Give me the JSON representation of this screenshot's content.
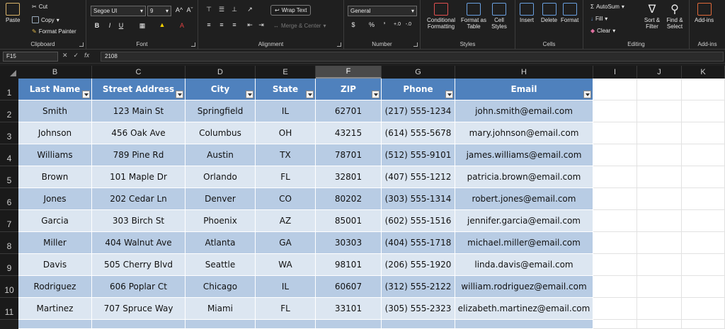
{
  "ribbon": {
    "clipboard": {
      "label": "Clipboard",
      "paste": "Paste",
      "cut": "Cut",
      "copy": "Copy",
      "format_painter": "Format Painter"
    },
    "font": {
      "label": "Font",
      "family": "Segoe UI",
      "size": "9",
      "grow": "A^",
      "shrink": "Aˇ",
      "bold": "B",
      "italic": "I",
      "underline": "U"
    },
    "alignment": {
      "label": "Alignment",
      "wrap_text": "Wrap Text",
      "merge_center": "Merge & Center"
    },
    "number": {
      "label": "Number",
      "format": "General",
      "currency": "$",
      "percent": "%",
      "comma": "’",
      "inc_decimal": "+.0",
      "dec_decimal": "-.0"
    },
    "styles": {
      "label": "Styles",
      "conditional": "Conditional Formatting",
      "format_table": "Format as Table",
      "cell_styles": "Cell Styles"
    },
    "cells": {
      "label": "Cells",
      "insert": "Insert",
      "delete": "Delete",
      "format": "Format"
    },
    "editing": {
      "label": "Editing",
      "autosum": "AutoSum",
      "fill": "Fill",
      "clear": "Clear",
      "sort_filter": "Sort & Filter",
      "find_select": "Find & Select"
    },
    "addins": {
      "label": "Add-ins",
      "addins": "Add-ins"
    }
  },
  "formula_bar": {
    "name_box": "F15",
    "fx": "fx",
    "value": "2108"
  },
  "columns": [
    "B",
    "C",
    "D",
    "E",
    "F",
    "G",
    "H",
    "I",
    "J",
    "K"
  ],
  "active_column": "F",
  "rows": [
    "1",
    "2",
    "3",
    "4",
    "5",
    "6",
    "7",
    "8",
    "9",
    "10",
    "11"
  ],
  "table": {
    "headers": [
      "Last Name",
      "Street Address",
      "City",
      "State",
      "ZIP",
      "Phone",
      "Email"
    ],
    "records": [
      [
        "Smith",
        "123 Main St",
        "Springfield",
        "IL",
        "62701",
        "(217) 555-1234",
        "john.smith@email.com"
      ],
      [
        "Johnson",
        "456 Oak Ave",
        "Columbus",
        "OH",
        "43215",
        "(614) 555-5678",
        "mary.johnson@email.com"
      ],
      [
        "Williams",
        "789 Pine Rd",
        "Austin",
        "TX",
        "78701",
        "(512) 555-9101",
        "james.williams@email.com"
      ],
      [
        "Brown",
        "101 Maple Dr",
        "Orlando",
        "FL",
        "32801",
        "(407) 555-1212",
        "patricia.brown@email.com"
      ],
      [
        "Jones",
        "202 Cedar Ln",
        "Denver",
        "CO",
        "80202",
        "(303) 555-1314",
        "robert.jones@email.com"
      ],
      [
        "Garcia",
        "303 Birch St",
        "Phoenix",
        "AZ",
        "85001",
        "(602) 555-1516",
        "jennifer.garcia@email.com"
      ],
      [
        "Miller",
        "404 Walnut Ave",
        "Atlanta",
        "GA",
        "30303",
        "(404) 555-1718",
        "michael.miller@email.com"
      ],
      [
        "Davis",
        "505 Cherry Blvd",
        "Seattle",
        "WA",
        "98101",
        "(206) 555-1920",
        "linda.davis@email.com"
      ],
      [
        "Rodriguez",
        "606 Poplar Ct",
        "Chicago",
        "IL",
        "60607",
        "(312) 555-2122",
        "william.rodriguez@email.com"
      ],
      [
        "Martinez",
        "707 Spruce Way",
        "Miami",
        "FL",
        "33101",
        "(305) 555-2323",
        "elizabeth.martinez@email.com"
      ]
    ]
  },
  "colors": {
    "header_fill": "#4f81bd",
    "band_dark": "#b8cce4",
    "band_light": "#dce6f1"
  }
}
